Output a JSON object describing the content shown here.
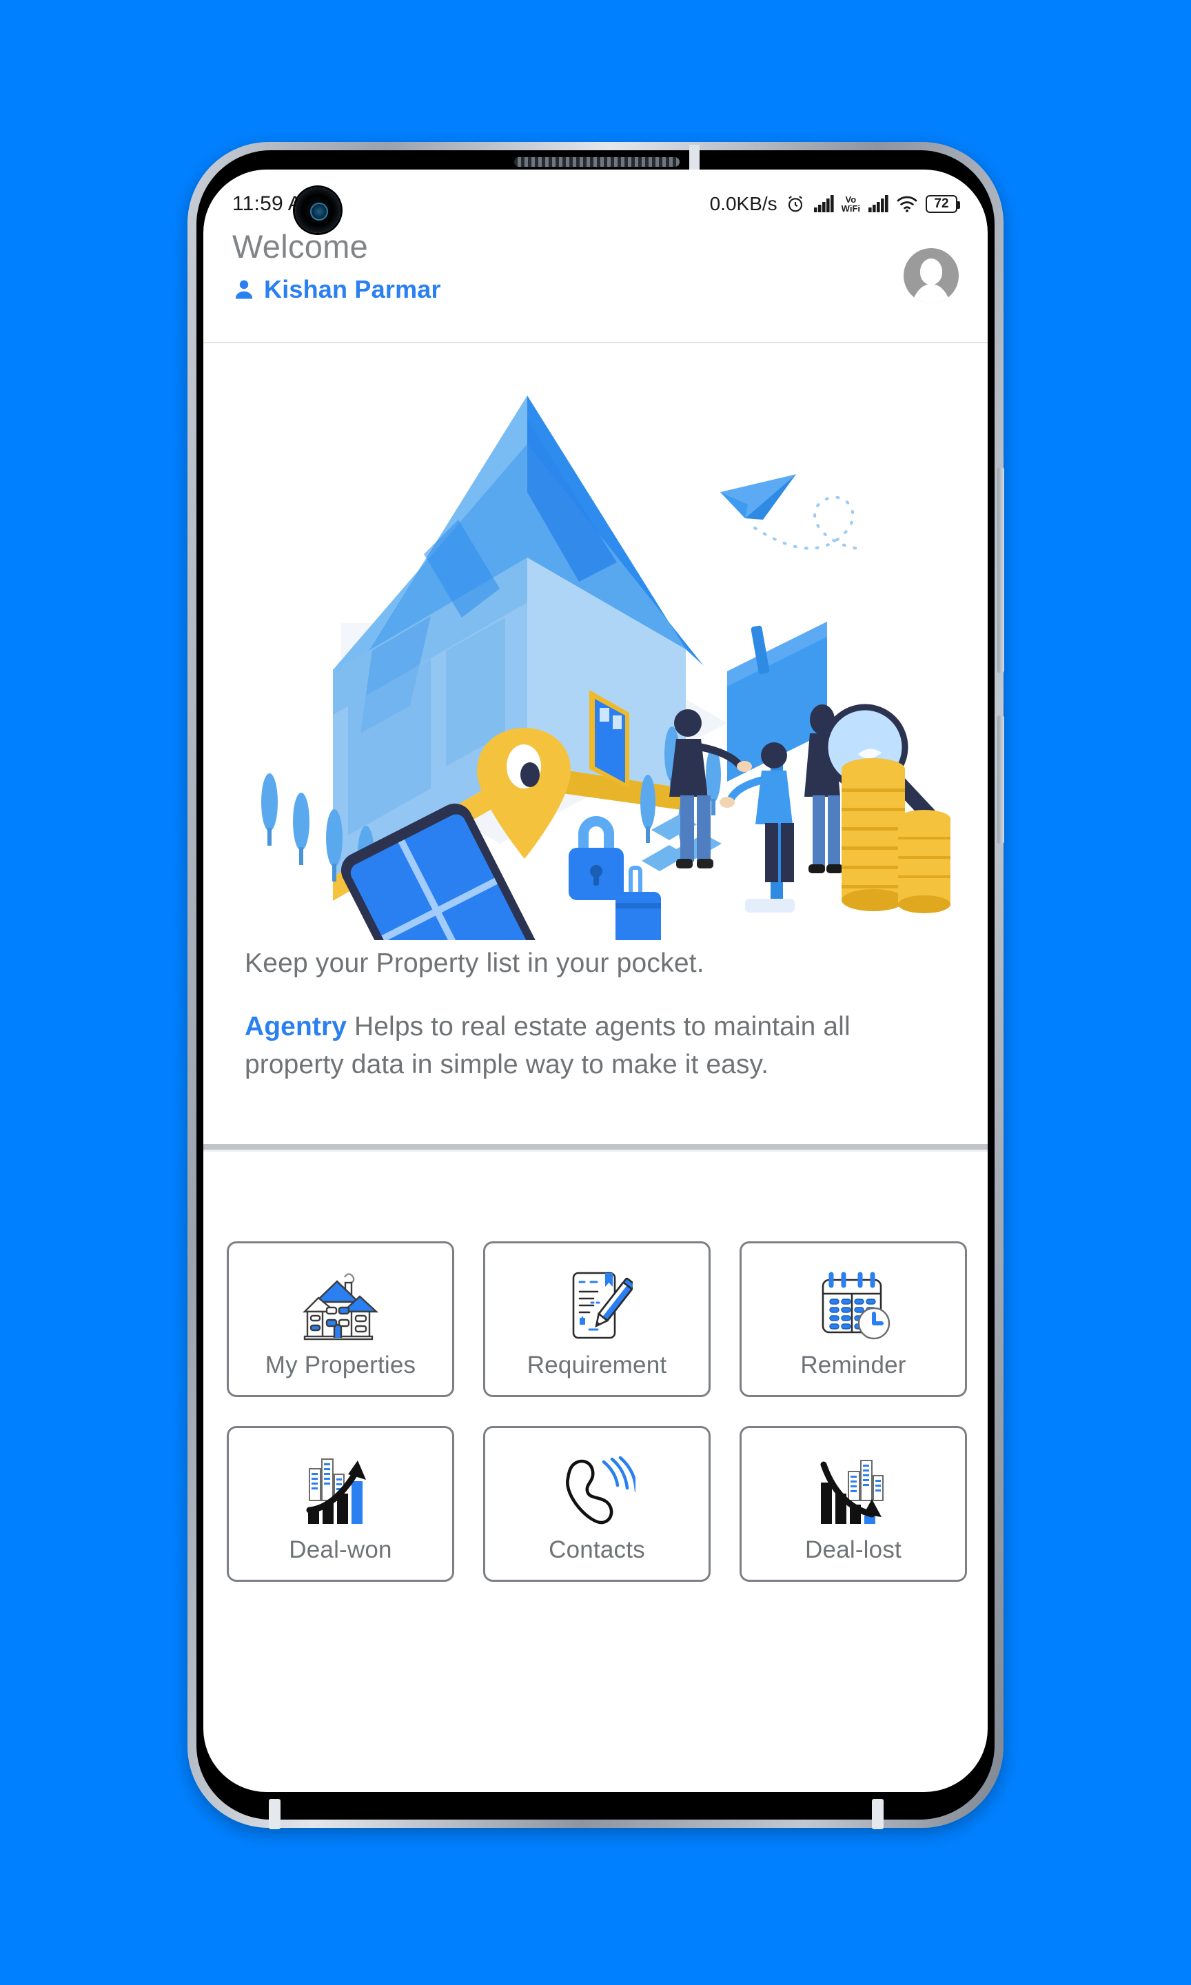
{
  "background_color": "#0080ff",
  "accent_color": "#2a7ff1",
  "text_color": "#6f7376",
  "status_bar": {
    "time": "11:59 AM",
    "network_speed": "0.0KB/s",
    "alarm_icon": "alarm-clock-icon",
    "signal_icon_1": "signal-bars-icon",
    "volte_label_top": "Vo",
    "volte_label_bottom": "WiFi",
    "signal_icon_2": "signal-bars-icon",
    "wifi_icon": "wifi-icon",
    "battery_level": "72"
  },
  "header": {
    "greeting": "Welcome",
    "user_name": "Kishan Parmar",
    "user_icon": "person-icon",
    "avatar_icon": "avatar-placeholder-icon"
  },
  "hero": {
    "illustration_name": "real-estate-isometric-illustration"
  },
  "intro": {
    "line1": "Keep your Property list in your pocket.",
    "brand": "Agentry",
    "line2_rest": " Helps to real estate agents to maintain all property data in simple way to make it easy."
  },
  "menu": {
    "items": [
      {
        "label": "My Properties",
        "icon": "house-icon"
      },
      {
        "label": "Requirement",
        "icon": "document-pen-icon"
      },
      {
        "label": "Reminder",
        "icon": "calendar-clock-icon"
      },
      {
        "label": "Deal-won",
        "icon": "chart-up-icon"
      },
      {
        "label": "Contacts",
        "icon": "phone-handset-icon"
      },
      {
        "label": "Deal-lost",
        "icon": "chart-down-icon"
      }
    ]
  }
}
